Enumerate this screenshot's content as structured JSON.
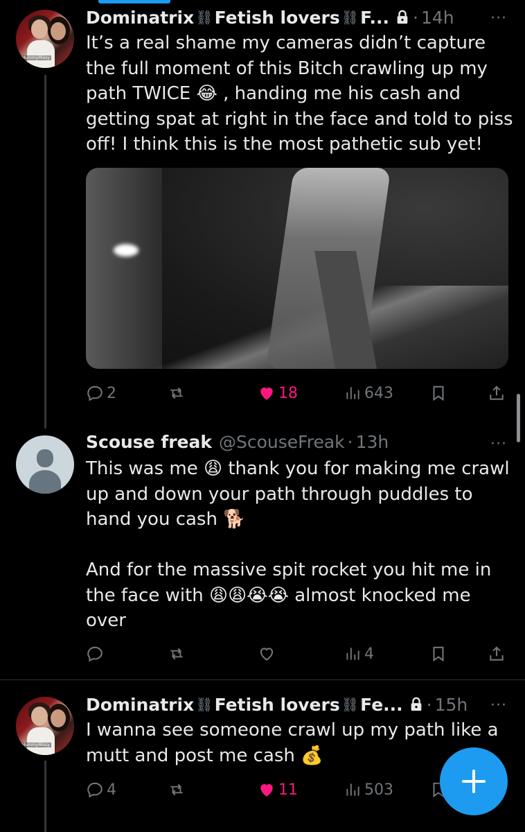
{
  "tweets": [
    {
      "author_name": "Dominatrix",
      "author_name_2": "Fetish lovers",
      "author_name_3": "F...",
      "dot": "·",
      "time": "14h",
      "more": "···",
      "avatar_tag": "MummyMissy",
      "text": "It’s a real shame my cameras didn’t capture the full moment of this Bitch crawling up my path TWICE 😂 , handing me his cash and getting spat at right in the face and told to piss off! I think this is the most pathetic sub yet!",
      "replies": "2",
      "likes": "18",
      "views": "643"
    },
    {
      "author_name": "Scouse freak",
      "handle": "@ScouseFreak",
      "dot": "·",
      "time": "13h",
      "more": "···",
      "text": "This was me 😩 thank you for making me crawl up and down your path through puddles to hand you cash 🐕\n\nAnd for the massive spit rocket you hit me in the face with 😩😩😭😭 almost knocked me over",
      "views": "4"
    },
    {
      "author_name": "Dominatrix",
      "author_name_2": "Fetish lovers",
      "author_name_3": "Fe...",
      "dot": "·",
      "time": "15h",
      "more": "···",
      "avatar_tag": "MummyMissy",
      "text": "I wanna see someone crawl up my path like a mutt and post me cash 💰",
      "replies": "4",
      "likes": "11",
      "views": "503"
    }
  ],
  "icons": {
    "chain": "⛓",
    "reply": "reply-icon",
    "retweet": "retweet-icon",
    "like": "heart-icon",
    "views": "views-icon",
    "bookmark": "bookmark-icon",
    "share": "share-icon",
    "compose": "plus-icon"
  },
  "colors": {
    "accent": "#1d9bf0",
    "like": "#f91880",
    "muted": "#71767b",
    "text": "#e7e9ea"
  }
}
